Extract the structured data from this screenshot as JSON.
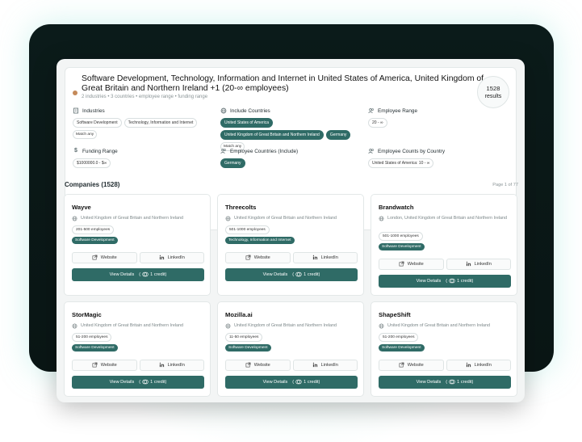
{
  "header": {
    "title": "Software Development, Technology, Information and Internet in United States of America, United Kingdom of Great Britain and Northern Ireland +1 (20-∞ employees)",
    "subtitle": "2 industries • 3 countries • employee range • funding range",
    "results_count": "1528",
    "results_label": "results"
  },
  "filters": {
    "industries": {
      "label": "Industries",
      "chips": [
        "Software Development",
        "Technology, Information and Internet"
      ],
      "match": "Match any"
    },
    "include_countries": {
      "label": "Include Countries",
      "chips": [
        "United States of America",
        "United Kingdom of Great Britain and Northern Ireland",
        "Germany"
      ],
      "match": "Match any"
    },
    "employee_range": {
      "label": "Employee Range",
      "chips": [
        "20 - ∞"
      ]
    },
    "funding_range": {
      "label": "Funding Range",
      "chips": [
        "$1000000.0 - $∞"
      ]
    },
    "employee_countries": {
      "label": "Employee Countries (Include)",
      "chips": [
        "Germany"
      ]
    },
    "employee_counts_by_country": {
      "label": "Employee Counts by Country",
      "chips": [
        "United States of America: 10 - ∞"
      ]
    }
  },
  "companies": {
    "title": "Companies (1528)",
    "page": "Page 1 of 77",
    "website_label": "Website",
    "linkedin_label": "LinkedIn",
    "details_label": "View Details",
    "credit_label": "1 credit)",
    "items": [
      {
        "name": "Wayve",
        "location": "United Kingdom of Great Britain and Northern Ireland",
        "employees": "201-500 employees",
        "industry": "Software Development"
      },
      {
        "name": "Threecolts",
        "location": "United Kingdom of Great Britain and Northern Ireland",
        "employees": "501-1000 employees",
        "industry": "Technology, Information and Internet"
      },
      {
        "name": "Brandwatch",
        "location": "London, United Kingdom of Great Britain and Northern Ireland",
        "employees": "501-1000 employees",
        "industry": "Software Development"
      },
      {
        "name": "StorMagic",
        "location": "United Kingdom of Great Britain and Northern Ireland",
        "employees": "51-200 employees",
        "industry": "Software Development"
      },
      {
        "name": "Mozilla.ai",
        "location": "United Kingdom of Great Britain and Northern Ireland",
        "employees": "11-50 employees",
        "industry": "Software Development"
      },
      {
        "name": "ShapeShift",
        "location": "United Kingdom of Great Britain and Northern Ireland",
        "employees": "51-200 employees",
        "industry": "Software Development"
      }
    ]
  },
  "colors": {
    "accent": "#2f6b66",
    "backdrop": "#0b1b1a",
    "surface": "#f3f5f5"
  }
}
